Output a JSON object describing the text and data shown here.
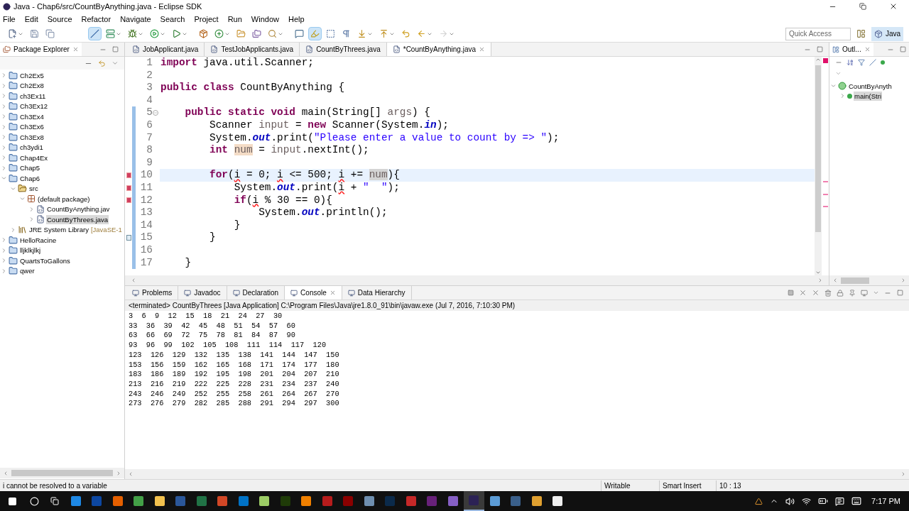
{
  "window": {
    "title": "Java - Chap6/src/CountByAnything.java - Eclipse SDK"
  },
  "menu": [
    "File",
    "Edit",
    "Source",
    "Refactor",
    "Navigate",
    "Search",
    "Project",
    "Run",
    "Window",
    "Help"
  ],
  "toolbar_groups": [
    {
      "items": [
        {
          "kind": "new",
          "dropdown": true,
          "pressed": false,
          "disabled": false
        },
        {
          "kind": "save",
          "dropdown": false,
          "pressed": false,
          "disabled": false
        },
        {
          "kind": "save_all",
          "dropdown": false,
          "pressed": false,
          "disabled": false
        }
      ]
    },
    {
      "items": [
        {
          "kind": "skip_breakpoints",
          "dropdown": false,
          "pressed": true,
          "disabled": false
        },
        {
          "kind": "server",
          "dropdown": true,
          "pressed": false,
          "disabled": false
        },
        {
          "kind": "debug",
          "dropdown": true,
          "pressed": false,
          "disabled": false
        },
        {
          "kind": "run",
          "dropdown": true,
          "pressed": false,
          "disabled": false
        },
        {
          "kind": "run_external",
          "dropdown": true,
          "pressed": false,
          "disabled": false
        }
      ]
    },
    {
      "items": [
        {
          "kind": "package",
          "dropdown": false,
          "pressed": false,
          "disabled": false
        },
        {
          "kind": "class",
          "dropdown": true,
          "pressed": false,
          "disabled": false
        },
        {
          "kind": "open_type",
          "dropdown": false,
          "pressed": false,
          "disabled": false
        },
        {
          "kind": "open_task",
          "dropdown": false,
          "pressed": false,
          "disabled": false
        },
        {
          "kind": "search",
          "dropdown": true,
          "pressed": false,
          "disabled": false
        }
      ]
    },
    {
      "items": [
        {
          "kind": "annotation",
          "dropdown": false,
          "pressed": false,
          "disabled": false
        },
        {
          "kind": "highlight",
          "dropdown": false,
          "pressed": true,
          "disabled": false
        },
        {
          "kind": "block",
          "dropdown": false,
          "pressed": false,
          "disabled": false
        },
        {
          "kind": "pilcrow",
          "dropdown": false,
          "pressed": false,
          "disabled": false
        },
        {
          "kind": "next",
          "dropdown": true,
          "pressed": false,
          "disabled": false
        },
        {
          "kind": "prev",
          "dropdown": true,
          "pressed": false,
          "disabled": false
        },
        {
          "kind": "last_edit",
          "dropdown": false,
          "pressed": false,
          "disabled": false
        },
        {
          "kind": "back",
          "dropdown": true,
          "pressed": false,
          "disabled": false
        },
        {
          "kind": "forward",
          "dropdown": true,
          "pressed": false,
          "disabled": true
        }
      ]
    }
  ],
  "quick_access": {
    "placeholder": "Quick Access"
  },
  "perspective": {
    "label": "Java",
    "selected": true
  },
  "package_explorer": {
    "title": "Package Explorer",
    "tree": [
      {
        "label": "Ch2Ex5",
        "kind": "project",
        "expanded": false,
        "selected": false
      },
      {
        "label": "Ch2Ex8",
        "kind": "project",
        "expanded": false,
        "selected": false
      },
      {
        "label": "ch3Ex11",
        "kind": "project",
        "expanded": false,
        "selected": false
      },
      {
        "label": "Ch3Ex12",
        "kind": "project",
        "expanded": false,
        "selected": false
      },
      {
        "label": "Ch3Ex4",
        "kind": "project",
        "expanded": false,
        "selected": false
      },
      {
        "label": "Ch3Ex6",
        "kind": "project",
        "expanded": false,
        "selected": false
      },
      {
        "label": "Ch3Ex8",
        "kind": "project",
        "expanded": false,
        "selected": false
      },
      {
        "label": "ch3ydi1",
        "kind": "project",
        "expanded": false,
        "selected": false
      },
      {
        "label": "Chap4Ex",
        "kind": "project",
        "expanded": false,
        "selected": false
      },
      {
        "label": "Chap5",
        "kind": "project",
        "expanded": false,
        "selected": false
      },
      {
        "label": "Chap6",
        "kind": "project",
        "expanded": true,
        "selected": false,
        "children": [
          {
            "label": "src",
            "kind": "source_folder",
            "expanded": true,
            "selected": false,
            "children": [
              {
                "label": "(default package)",
                "kind": "package",
                "expanded": true,
                "selected": false,
                "children": [
                  {
                    "label": "CountByAnything.jav",
                    "kind": "file",
                    "expanded": false,
                    "selected": false
                  },
                  {
                    "label": "CountByThrees.java",
                    "kind": "file",
                    "expanded": false,
                    "selected": true
                  }
                ]
              }
            ]
          },
          {
            "label": "JRE System Library",
            "suffix": "[JavaSE-1",
            "kind": "library",
            "expanded": false,
            "selected": false
          }
        ]
      },
      {
        "label": "HelloRacine",
        "kind": "project",
        "expanded": false,
        "selected": false
      },
      {
        "label": "lljklkjlkj",
        "kind": "project",
        "expanded": false,
        "selected": false
      },
      {
        "label": "QuartsToGallons",
        "kind": "project",
        "expanded": false,
        "selected": false
      },
      {
        "label": "qwer",
        "kind": "project",
        "expanded": false,
        "selected": false
      }
    ]
  },
  "editor": {
    "tabs": [
      {
        "label": "JobApplicant.java",
        "selected": false
      },
      {
        "label": "TestJobApplicants.java",
        "selected": false
      },
      {
        "label": "CountByThrees.java",
        "selected": false
      },
      {
        "label": "*CountByAnything.java",
        "selected": true
      }
    ],
    "lines": [
      {
        "number": "1",
        "kind": "plain",
        "changed": false,
        "current": false,
        "segments": [
          {
            "kind": "keyword",
            "text": "import"
          },
          {
            "kind": "text",
            "text": " java.util.Scanner;"
          }
        ]
      },
      {
        "number": "2",
        "kind": "plain",
        "changed": false,
        "current": false
      },
      {
        "number": "3",
        "kind": "plain",
        "changed": false,
        "current": false,
        "segments": [
          {
            "kind": "keyword",
            "text": "public class"
          },
          {
            "kind": "text",
            "text": " CountByAnything {"
          }
        ]
      },
      {
        "number": "4",
        "kind": "plain",
        "changed": false,
        "current": false
      },
      {
        "number": "5",
        "kind": "fold",
        "changed": true,
        "current": false,
        "segments": [
          {
            "kind": "keyword",
            "text": "    public static void"
          },
          {
            "kind": "text",
            "text": " main(String[] "
          },
          {
            "kind": "variable",
            "text": "args"
          },
          {
            "kind": "text",
            "text": ") {"
          }
        ]
      },
      {
        "number": "6",
        "kind": "plain",
        "changed": true,
        "current": false,
        "segments": [
          {
            "kind": "text",
            "text": "        Scanner "
          },
          {
            "kind": "variable",
            "text": "input"
          },
          {
            "kind": "text",
            "text": " = "
          },
          {
            "kind": "keyword",
            "text": "new"
          },
          {
            "kind": "text",
            "text": " Scanner(System."
          },
          {
            "kind": "static_field",
            "text": "in"
          },
          {
            "kind": "text",
            "text": ");"
          }
        ]
      },
      {
        "number": "7",
        "kind": "plain",
        "changed": true,
        "current": false,
        "segments": [
          {
            "kind": "text",
            "text": "        System."
          },
          {
            "kind": "static_field",
            "text": "out"
          },
          {
            "kind": "text",
            "text": ".print("
          },
          {
            "kind": "string",
            "text": "\"Please enter a value to count by => \""
          },
          {
            "kind": "text",
            "text": ");"
          }
        ]
      },
      {
        "number": "8",
        "kind": "plain",
        "changed": true,
        "current": false,
        "segments": [
          {
            "kind": "keyword",
            "text": "        int"
          },
          {
            "kind": "write_occurrence",
            "text": " num"
          },
          {
            "kind": "text",
            "text": " = "
          },
          {
            "kind": "variable",
            "text": "input"
          },
          {
            "kind": "text",
            "text": ".nextInt();"
          }
        ]
      },
      {
        "number": "9",
        "kind": "plain",
        "changed": true,
        "current": false
      },
      {
        "number": "10",
        "kind": "error",
        "changed": true,
        "current": true,
        "segments": [
          {
            "kind": "keyword",
            "text": "        for"
          },
          {
            "kind": "text",
            "text": "("
          },
          {
            "kind": "error",
            "text": "i"
          },
          {
            "kind": "text",
            "text": " = 0; "
          },
          {
            "kind": "error",
            "text": "i"
          },
          {
            "kind": "text",
            "text": " <= 500; "
          },
          {
            "kind": "error",
            "text": "i"
          },
          {
            "kind": "text",
            "text": " += "
          },
          {
            "kind": "read_occurrence",
            "text": "num"
          },
          {
            "kind": "text",
            "text": "){"
          }
        ]
      },
      {
        "number": "11",
        "kind": "error",
        "changed": true,
        "current": false,
        "segments": [
          {
            "kind": "text",
            "text": "            System."
          },
          {
            "kind": "static_field",
            "text": "out"
          },
          {
            "kind": "text",
            "text": ".print("
          },
          {
            "kind": "error",
            "text": "i"
          },
          {
            "kind": "text",
            "text": " + "
          },
          {
            "kind": "string",
            "text": "\"  \""
          },
          {
            "kind": "text",
            "text": ");"
          }
        ]
      },
      {
        "number": "12",
        "kind": "error",
        "changed": true,
        "current": false,
        "segments": [
          {
            "kind": "keyword",
            "text": "            if"
          },
          {
            "kind": "text",
            "text": "("
          },
          {
            "kind": "error",
            "text": "i"
          },
          {
            "kind": "text",
            "text": " % 30 == 0){"
          }
        ]
      },
      {
        "number": "13",
        "kind": "plain",
        "changed": true,
        "current": false,
        "segments": [
          {
            "kind": "text",
            "text": "                System."
          },
          {
            "kind": "static_field",
            "text": "out"
          },
          {
            "kind": "text",
            "text": ".println();"
          }
        ]
      },
      {
        "number": "14",
        "kind": "plain",
        "changed": true,
        "current": false,
        "segments": [
          {
            "kind": "text",
            "text": "            }"
          }
        ]
      },
      {
        "number": "15",
        "kind": "annotation",
        "changed": true,
        "current": false,
        "segments": [
          {
            "kind": "text",
            "text": "        }"
          }
        ]
      },
      {
        "number": "16",
        "kind": "plain",
        "changed": true,
        "current": false
      },
      {
        "number": "17",
        "kind": "plain",
        "changed": true,
        "current": false,
        "segments": [
          {
            "kind": "text",
            "text": "    }"
          }
        ]
      }
    ]
  },
  "outline": {
    "title": "Outl...",
    "tree": [
      {
        "label": "CountByAnyth",
        "kind": "class",
        "expanded": true,
        "selected": false,
        "children": [
          {
            "label": "main(Stri",
            "kind": "method",
            "expanded": false,
            "selected": true
          }
        ]
      }
    ]
  },
  "bottom_panel": {
    "tabs": [
      {
        "label": "Problems",
        "selected": false
      },
      {
        "label": "Javadoc",
        "selected": false
      },
      {
        "label": "Declaration",
        "selected": false
      },
      {
        "label": "Console",
        "selected": true
      },
      {
        "label": "Data Hierarchy",
        "selected": false
      }
    ],
    "console_header": "<terminated> CountByThrees [Java Application] C:\\Program Files\\Java\\jre1.8.0_91\\bin\\javaw.exe (Jul 7, 2016, 7:10:30 PM)",
    "output": [
      "3  6  9  12  15  18  21  24  27  30",
      "33  36  39  42  45  48  51  54  57  60",
      "63  66  69  72  75  78  81  84  87  90",
      "93  96  99  102  105  108  111  114  117  120",
      "123  126  129  132  135  138  141  144  147  150",
      "153  156  159  162  165  168  171  174  177  180",
      "183  186  189  192  195  198  201  204  207  210",
      "213  216  219  222  225  228  231  234  237  240",
      "243  246  249  252  255  258  261  264  267  270",
      "273  276  279  282  285  288  291  294  297  300"
    ]
  },
  "status_bar": {
    "message": "i cannot be resolved to a variable",
    "mode": "Writable",
    "insert_mode": "Smart Insert",
    "position": "10 : 13"
  },
  "taskbar": {
    "apps": [
      {
        "color": "#1e88e5",
        "selected": false
      },
      {
        "color": "#0d47a1",
        "selected": false
      },
      {
        "color": "#e66000",
        "selected": false
      },
      {
        "color": "#43a047",
        "selected": false
      },
      {
        "color": "#f2c14e",
        "selected": false
      },
      {
        "color": "#2b579a",
        "selected": false
      },
      {
        "color": "#217346",
        "selected": false
      },
      {
        "color": "#d24726",
        "selected": false
      },
      {
        "color": "#0072c6",
        "selected": false
      },
      {
        "color": "#9ccc65",
        "selected": false
      },
      {
        "color": "#1f3b08",
        "selected": false
      },
      {
        "color": "#f08000",
        "selected": false
      },
      {
        "color": "#b71c1c",
        "selected": false
      },
      {
        "color": "#8b0000",
        "selected": false
      },
      {
        "color": "#6f8fb0",
        "selected": false
      },
      {
        "color": "#0b2a4a",
        "selected": false
      },
      {
        "color": "#c62828",
        "selected": false
      },
      {
        "color": "#68217a",
        "selected": false
      },
      {
        "color": "#865fc5",
        "selected": false
      },
      {
        "color": "#2c2255",
        "selected": true
      },
      {
        "color": "#5b9bd5",
        "selected": false
      },
      {
        "color": "#3a5f8a",
        "selected": false
      },
      {
        "color": "#e0a030",
        "selected": false
      },
      {
        "color": "#eeeeee",
        "selected": false
      }
    ],
    "time": "7:17 PM"
  }
}
